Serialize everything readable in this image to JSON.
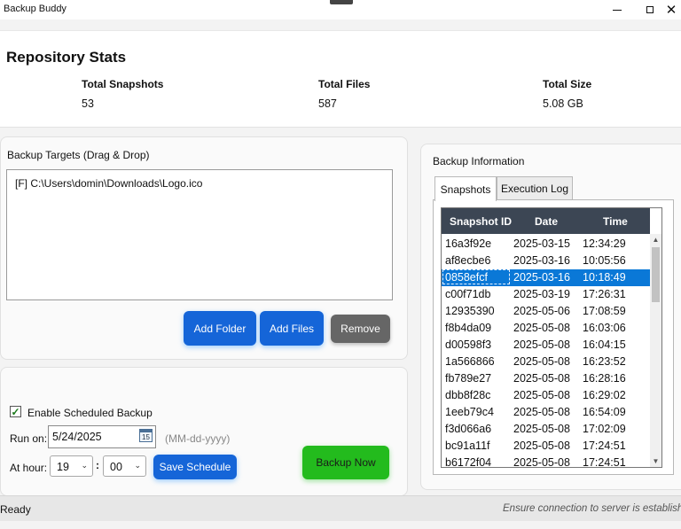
{
  "window": {
    "title": "Backup Buddy",
    "minimize_icon": "minimize-icon",
    "maximize_icon": "maximize-icon",
    "close_glyph": "✕"
  },
  "stats": {
    "title": "Repository Stats",
    "items": [
      {
        "label": "Total Snapshots",
        "value": "53"
      },
      {
        "label": "Total Files",
        "value": "587"
      },
      {
        "label": "Total Size",
        "value": "5.08 GB"
      }
    ]
  },
  "targets": {
    "title": "Backup Targets (Drag & Drop)",
    "items": [
      "[F] C:\\Users\\domin\\Downloads\\Logo.ico"
    ],
    "add_folder_label": "Add Folder",
    "add_files_label": "Add Files",
    "remove_label": "Remove"
  },
  "schedule": {
    "enable_label": "Enable Scheduled Backup",
    "enabled": true,
    "run_on_label": "Run on:",
    "date_value": "5/24/2025",
    "calendar_day": "15",
    "date_hint": "(MM-dd-yyyy)",
    "at_hour_label": "At hour:",
    "hour_value": "19",
    "separator": ":",
    "minute_value": "00",
    "save_label": "Save Schedule",
    "backup_now_label": "Backup Now"
  },
  "info": {
    "title": "Backup Information",
    "tabs": [
      {
        "label": "Snapshots",
        "active": true
      },
      {
        "label": "Execution Log",
        "active": false
      }
    ],
    "columns": [
      "Snapshot ID",
      "Date",
      "Time"
    ],
    "rows": [
      {
        "id": "16a3f92e",
        "date": "2025-03-15",
        "time": "12:34:29"
      },
      {
        "id": "af8ecbe6",
        "date": "2025-03-16",
        "time": "10:05:56"
      },
      {
        "id": "0858efcf",
        "date": "2025-03-16",
        "time": "10:18:49"
      },
      {
        "id": "c00f71db",
        "date": "2025-03-19",
        "time": "17:26:31"
      },
      {
        "id": "12935390",
        "date": "2025-05-06",
        "time": "17:08:59"
      },
      {
        "id": "f8b4da09",
        "date": "2025-05-08",
        "time": "16:03:06"
      },
      {
        "id": "d00598f3",
        "date": "2025-05-08",
        "time": "16:04:15"
      },
      {
        "id": "1a566866",
        "date": "2025-05-08",
        "time": "16:23:52"
      },
      {
        "id": "fb789e27",
        "date": "2025-05-08",
        "time": "16:28:16"
      },
      {
        "id": "dbb8f28c",
        "date": "2025-05-08",
        "time": "16:29:02"
      },
      {
        "id": "1eeb79c4",
        "date": "2025-05-08",
        "time": "16:54:09"
      },
      {
        "id": "f3d066a6",
        "date": "2025-05-08",
        "time": "17:02:09"
      },
      {
        "id": "bc91a11f",
        "date": "2025-05-08",
        "time": "17:24:51"
      },
      {
        "id": "b6172f04",
        "date": "2025-05-08",
        "time": "17:24:51"
      }
    ],
    "selected_row": 2
  },
  "status": {
    "left": "Ready",
    "right": "Ensure connection to server is established"
  },
  "colors": {
    "accent_blue": "#1565d8",
    "selection_blue": "#0a78d7",
    "backup_green": "#23bb1d",
    "header_dark": "#3c4654"
  }
}
